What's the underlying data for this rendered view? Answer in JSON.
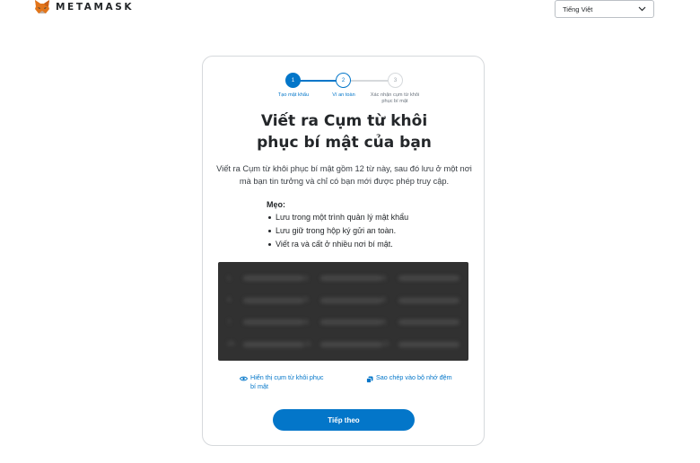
{
  "header": {
    "logo_text": "METAMASK",
    "language_select": {
      "selected": "Tiếng Việt"
    }
  },
  "stepper": {
    "steps": [
      {
        "number": "1",
        "label": "Tạo mật khẩu",
        "state": "complete"
      },
      {
        "number": "2",
        "label": "Ví an toàn",
        "state": "active"
      },
      {
        "number": "3",
        "label": "Xác nhận cụm từ khôi phục bí mật",
        "state": "pending"
      }
    ]
  },
  "main": {
    "title": "Viết ra Cụm từ khôi phục bí mật của bạn",
    "description": "Viết ra Cụm từ khôi phục bí mật gồm 12 từ này, sau đó lưu ở một nơi mà bạn tin tưởng và chỉ có bạn mới được phép truy cập.",
    "tips_title": "Mẹo:",
    "tips": [
      "Lưu trong một trình quản lý mật khẩu",
      "Lưu giữ trong hộp ký gửi an toàn.",
      "Viết ra và cất ở nhiều nơi bí mật."
    ],
    "phrase_numbers": [
      "1.",
      "2.",
      "3.",
      "4.",
      "5.",
      "6.",
      "7.",
      "8.",
      "9.",
      "10.",
      "11.",
      "12."
    ],
    "reveal_label": "Hiển thị cụm từ khôi phục bí mật",
    "copy_label": "Sao chép vào bộ nhớ đệm",
    "next_button": "Tiếp theo"
  },
  "colors": {
    "accent": "#0376c9",
    "phrase_box": "#313131",
    "fox_orange": "#e2761b"
  }
}
